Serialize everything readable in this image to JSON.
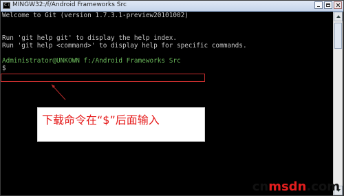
{
  "window": {
    "title": "MINGW32:/f/Android Frameworks Src",
    "controls": {
      "minimize": "minimize",
      "maximize": "maximize",
      "close": "close"
    },
    "icon": "terminal-icon"
  },
  "console": {
    "lines": [
      "Welcome to Git (version 1.7.3.1-preview20101002)",
      "",
      "",
      "Run 'git help git' to display the help index.",
      "Run 'git help <command>' to display help for specific commands.",
      "",
      "Administrator@UNKOWN f:/Android Frameworks Src",
      "$"
    ]
  },
  "annotation": {
    "callout_text": "下载命令在“$”后面输入"
  },
  "watermark": {
    "part1": "cn",
    "part2": "msdn",
    "part3": ".com"
  },
  "colors": {
    "terminal_bg": "#000000",
    "terminal_text": "#c8c8c8",
    "prompt_green": "#6ab75a",
    "annotation_red": "#e51a1a"
  }
}
